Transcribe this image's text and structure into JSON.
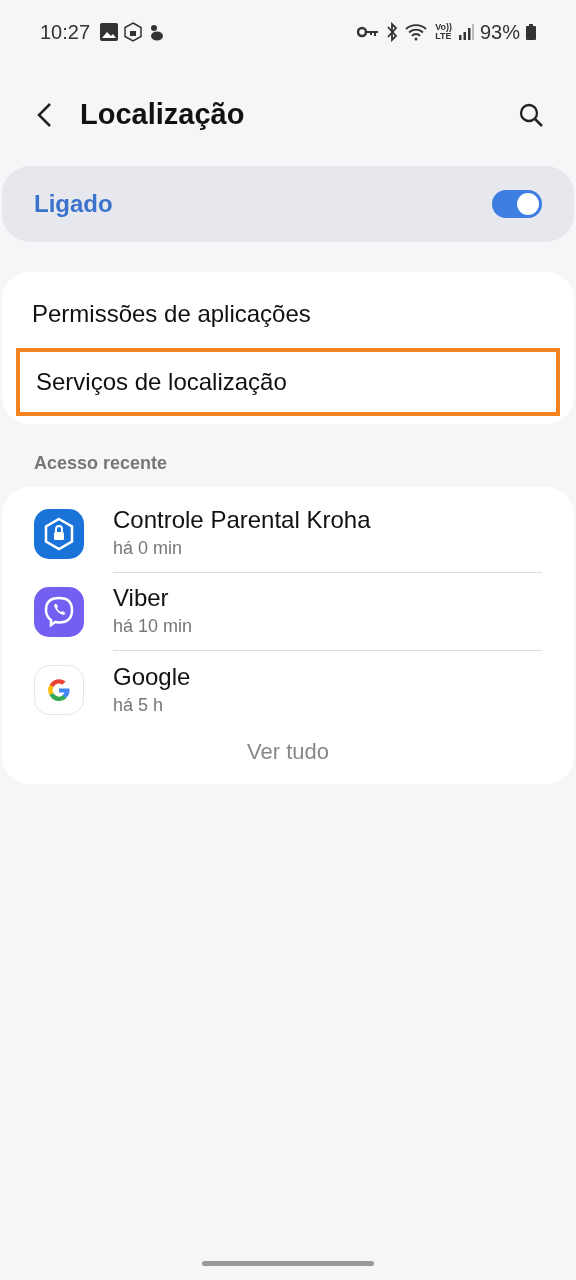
{
  "status_bar": {
    "time": "10:27",
    "network_lines": [
      "Vo))",
      "LTE"
    ],
    "battery": "93%"
  },
  "header": {
    "title": "Localização"
  },
  "master_switch": {
    "label": "Ligado",
    "on": true
  },
  "menu": [
    {
      "label": "Permissões de aplicações",
      "highlighted": false
    },
    {
      "label": "Serviços de localização",
      "highlighted": true
    }
  ],
  "recent": {
    "heading": "Acesso recente",
    "apps": [
      {
        "kind": "lock",
        "name": "Controle Parental Kroha",
        "time": "há 0 min"
      },
      {
        "kind": "phone",
        "name": "Viber",
        "time": "há 10 min"
      },
      {
        "kind": "google",
        "name": "Google",
        "time": "há 5 h"
      }
    ],
    "see_all": "Ver tudo"
  }
}
